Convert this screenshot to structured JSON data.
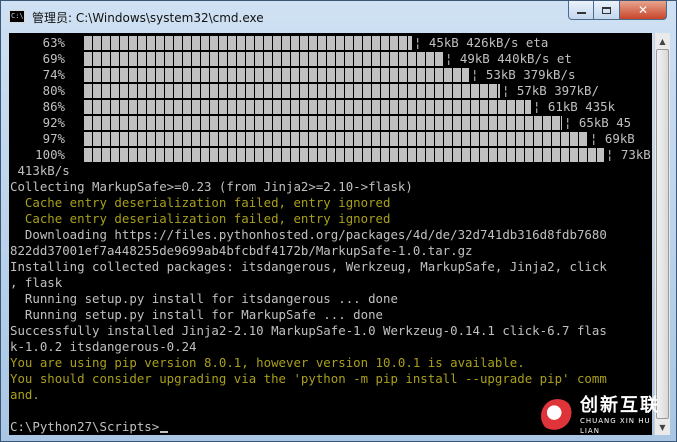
{
  "window": {
    "title": "管理员: C:\\Windows\\system32\\cmd.exe",
    "icon": "cmd-icon",
    "controls": {
      "minimize": "minimize-icon",
      "maximize": "maximize-icon",
      "close": "close-icon"
    }
  },
  "console": {
    "progress_rows": [
      {
        "pct": "63%",
        "fill": 0.63,
        "tail": "¦ 45kB 426kB/s eta"
      },
      {
        "pct": "69%",
        "fill": 0.69,
        "tail": "¦ 49kB 440kB/s et"
      },
      {
        "pct": "74%",
        "fill": 0.74,
        "tail": "¦ 53kB 379kB/s"
      },
      {
        "pct": "80%",
        "fill": 0.8,
        "tail": "¦ 57kB 397kB/"
      },
      {
        "pct": "86%",
        "fill": 0.86,
        "tail": "¦ 61kB 435k"
      },
      {
        "pct": "92%",
        "fill": 0.92,
        "tail": "¦ 65kB 45"
      },
      {
        "pct": "97%",
        "fill": 0.97,
        "tail": "¦ 69kB"
      },
      {
        "pct": "100%",
        "fill": 1.0,
        "tail": "¦ 73kB"
      }
    ],
    "lines": [
      {
        "text": " 413kB/s",
        "color": "gray"
      },
      {
        "text": "Collecting MarkupSafe>=0.23 (from Jinja2>=2.10->flask)",
        "color": "gray"
      },
      {
        "text": "  Cache entry deserialization failed, entry ignored",
        "color": "yellow"
      },
      {
        "text": "  Cache entry deserialization failed, entry ignored",
        "color": "yellow"
      },
      {
        "text": "  Downloading https://files.pythonhosted.org/packages/4d/de/32d741db316d8fdb7680",
        "color": "gray"
      },
      {
        "text": "822dd37001ef7a448255de9699ab4bfcbdf4172b/MarkupSafe-1.0.tar.gz",
        "color": "gray"
      },
      {
        "text": "Installing collected packages: itsdangerous, Werkzeug, MarkupSafe, Jinja2, click",
        "color": "gray"
      },
      {
        "text": ", flask",
        "color": "gray"
      },
      {
        "text": "  Running setup.py install for itsdangerous ... done",
        "color": "gray"
      },
      {
        "text": "  Running setup.py install for MarkupSafe ... done",
        "color": "gray"
      },
      {
        "text": "Successfully installed Jinja2-2.10 MarkupSafe-1.0 Werkzeug-0.14.1 click-6.7 flas",
        "color": "gray"
      },
      {
        "text": "k-1.0.2 itsdangerous-0.24",
        "color": "gray"
      },
      {
        "text": "You are using pip version 8.0.1, however version 10.0.1 is available.",
        "color": "yellow"
      },
      {
        "text": "You should consider upgrading via the 'python -m pip install --upgrade pip' comm",
        "color": "yellow"
      },
      {
        "text": "and.",
        "color": "yellow"
      },
      {
        "text": "",
        "color": "gray"
      },
      {
        "text": "C:\\Python27\\Scripts>",
        "color": "gray"
      }
    ],
    "colors": {
      "gray": "#c0c0c0",
      "yellow": "#a99f1d",
      "background": "#000000"
    }
  },
  "watermark": {
    "main": "创新互联",
    "sub": "CHUANG XIN HU LIAN"
  }
}
